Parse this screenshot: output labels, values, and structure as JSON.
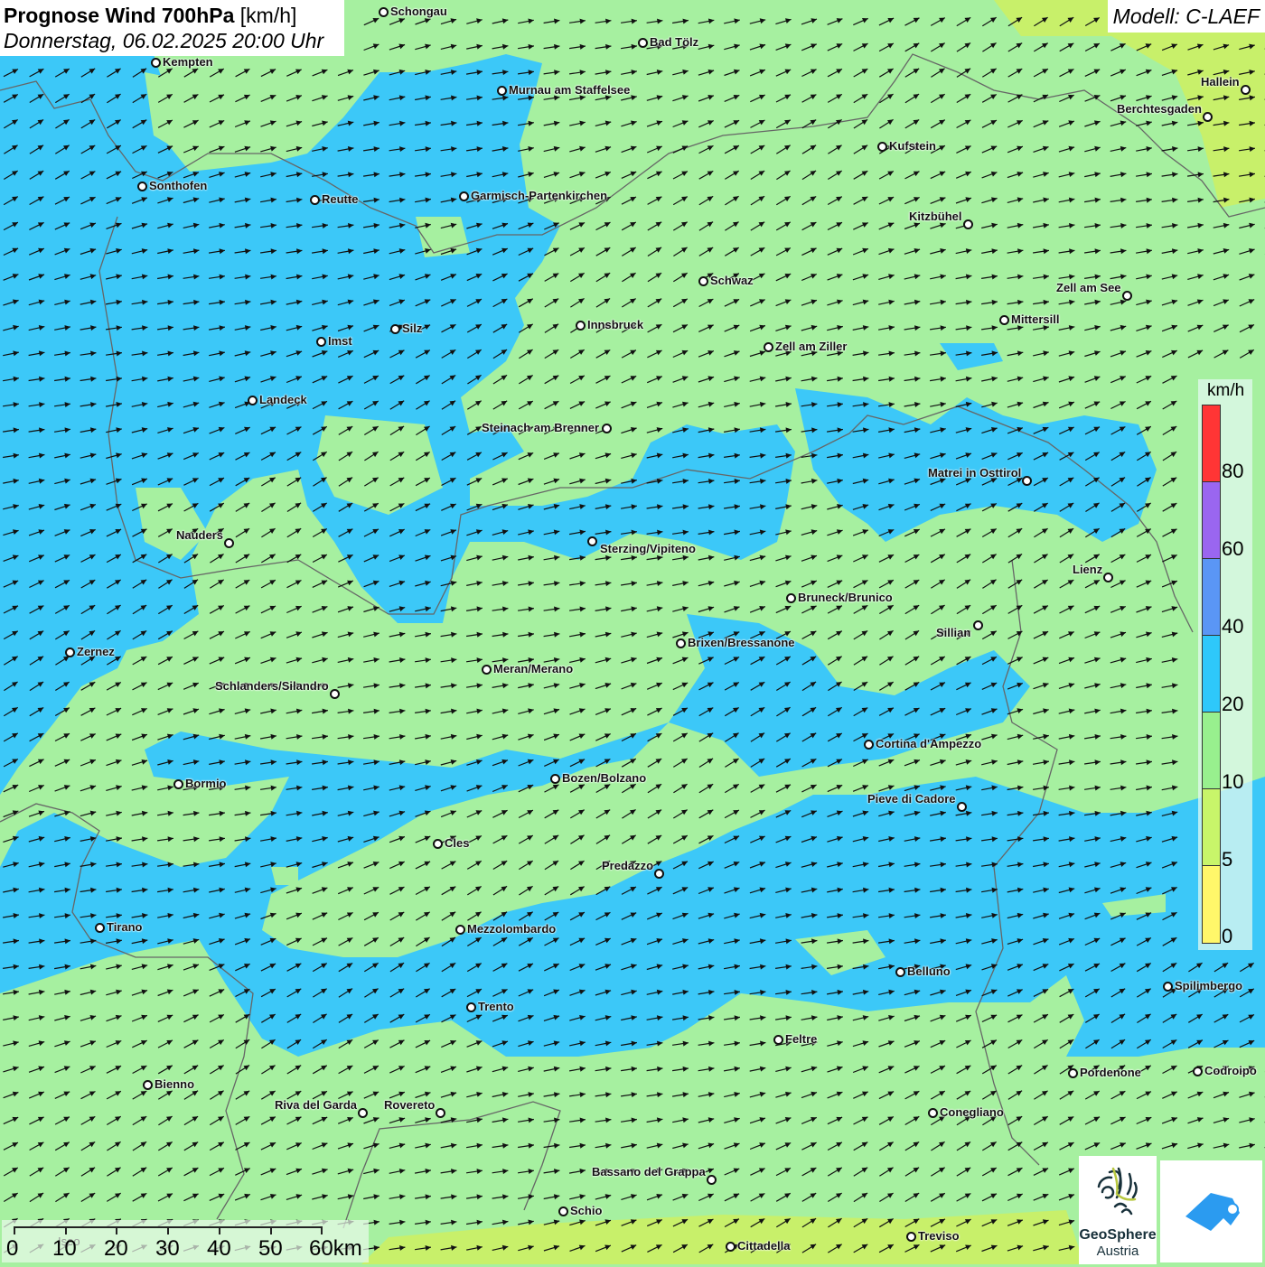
{
  "header": {
    "title_bold": "Prognose Wind 700hPa",
    "title_unit": "[km/h]",
    "datetime": "Donnerstag, 06.02.2025 20:00 Uhr",
    "model": "Modell: C-LAEF"
  },
  "legend": {
    "unit": "km/h",
    "ticks": [
      "80",
      "60",
      "40",
      "20",
      "10",
      "5",
      "0"
    ],
    "colors": [
      "#ff3535",
      "#9a66f0",
      "#5a96f5",
      "#2ec8fa",
      "#98f08e",
      "#c8f56a",
      "#fff76a"
    ]
  },
  "scale_bar": {
    "labels": [
      "0",
      "10",
      "20",
      "30",
      "40",
      "50",
      "60km"
    ],
    "faded_place": "Iseo"
  },
  "cities": [
    "Schongau",
    "Bad Tölz",
    "Kempten",
    "Murnau am Staffelsee",
    "Hallein",
    "Berchtesgaden",
    "Kufstein",
    "Sonthofen",
    "Reutte",
    "Garmisch-Partenkirchen",
    "Kitzbühel",
    "Schwaz",
    "Zell am See",
    "Mittersill",
    "Innsbruck",
    "Silz",
    "Imst",
    "Zell am Ziller",
    "Landeck",
    "Steinach am Brenner",
    "Matrei in Osttirol",
    "Nauders",
    "Sterzing/Vipiteno",
    "Lienz",
    "Bruneck/Brunico",
    "Sillian",
    "Brixen/Bressanone",
    "Zernez",
    "Meran/Merano",
    "Schlanders/Silandro",
    "Cortina d'Ampezzo",
    "Bozen/Bolzano",
    "Bormio",
    "Pieve di Cadore",
    "Cles",
    "Predazzo",
    "Tirano",
    "Mezzolombardo",
    "Belluno",
    "Spilimbergo",
    "Trento",
    "Feltre",
    "Pordenone",
    "Codroipo",
    "Bienno",
    "Riva del Garda",
    "Rovereto",
    "Conegliano",
    "Bassano del Grappa",
    "Schio",
    "Treviso",
    "Cittadella"
  ],
  "logos": {
    "geosphere_line1": "GeoSphere",
    "geosphere_line2": "Austria"
  },
  "colors": {
    "wind_10_20": "#a6f0a0",
    "wind_20_40": "#3cc8f8",
    "wind_5_10": "#c8f06a"
  }
}
